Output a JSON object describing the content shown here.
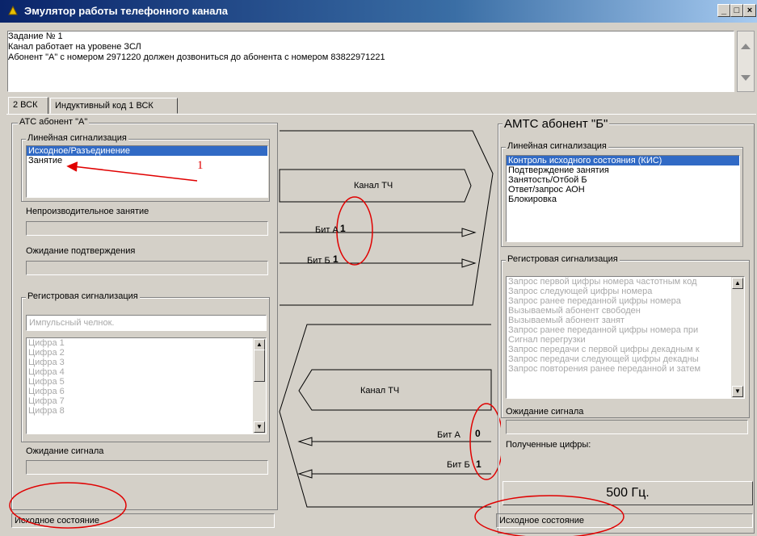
{
  "window": {
    "title": "Эмулятор работы телефонного канала",
    "controls": [
      "_",
      "□",
      "×"
    ]
  },
  "task": {
    "lines": [
      "Задание № 1",
      "Канал работает на уровене ЗСЛ",
      "Абонент \"А\" с номером 2971220 должен дозвониться до абонента с номером 83822971221"
    ]
  },
  "tabs": [
    {
      "label": "2 ВСК",
      "active": true
    },
    {
      "label": "Индуктивный код 1 ВСК",
      "active": false
    }
  ],
  "left": {
    "group_title": "АТС  абонент \"А\"",
    "linear": {
      "title": "Линейная сигнализация",
      "items": [
        "Исходное/Разъединение",
        "Занятие"
      ],
      "selected": 0
    },
    "annotation_number": "1",
    "unproductive_label": "Непроизводительное занятие",
    "await_confirm_label": "Ожидание подтверждения",
    "register": {
      "title": "Регистровая сигнализация",
      "placeholder": "Импульсный челнок.",
      "digits": [
        "Цифра 1",
        "Цифра 2",
        "Цифра 3",
        "Цифра 4",
        "Цифра 5",
        "Цифра 6",
        "Цифра 7",
        "Цифра 8"
      ]
    },
    "await_signal_label": "Ожидание сигнала",
    "status": "Исходное состояние"
  },
  "center": {
    "forward": {
      "channel_label": "Канал ТЧ",
      "bit_a_label": "Бит А",
      "bit_a_value": "1",
      "bit_b_label": "Бит Б",
      "bit_b_value": "1"
    },
    "backward": {
      "channel_label": "Канал ТЧ",
      "bit_a_label": "Бит А",
      "bit_a_value": "0",
      "bit_b_label": "Бит Б",
      "bit_b_value": "1"
    }
  },
  "right": {
    "group_title": "АМТС  абонент \"Б\"",
    "linear": {
      "title": "Линейная сигнализация",
      "items": [
        "Контроль исходного состояния (КИС)",
        "Подтверждение занятия",
        "Занятость/Отбой Б",
        "Ответ/запрос АОН",
        "Блокировка"
      ],
      "selected": 0
    },
    "register": {
      "title": "Регистровая сигнализация",
      "items": [
        "Запрос первой цифры номера частотным код",
        "Запрос следующей цифры номера",
        "Запрос ранее переданной цифры номера",
        "Вызываемый абонент свободен",
        "Вызываемый абонент занят",
        "Запрос ранее переданной цифры номера при",
        "Сигнал перегрузки",
        "Запрос передачи с первой цифры декадным к",
        "Запрос передачи следующей цифры декадны",
        "Запрос повторения ранее переданной и затем"
      ]
    },
    "await_signal_label": "Ожидание сигнала",
    "received_digits_label": "Полученные цифры:",
    "tone_button": "500 Гц.",
    "status": "Исходное состояние"
  },
  "colors": {
    "selection": "#316ac5",
    "annotation": "#e00000",
    "face": "#d4d0c8"
  }
}
